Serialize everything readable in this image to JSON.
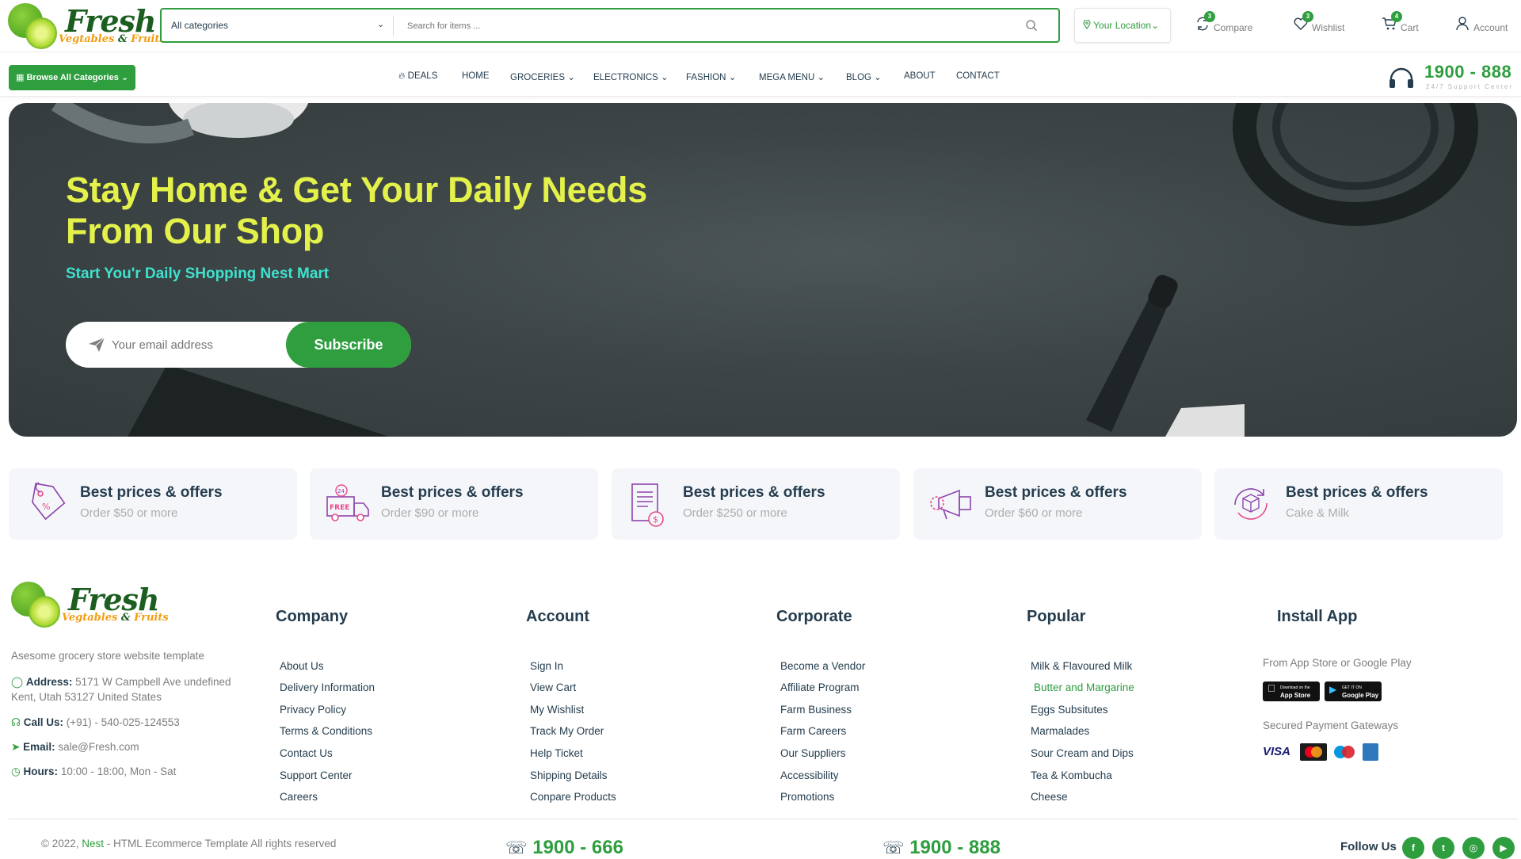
{
  "logo": {
    "word": "Fresh",
    "sub_a": "Vegtables",
    "sub_amp": " & ",
    "sub_b": "Fruits"
  },
  "search": {
    "category": "All categories",
    "placeholder": "Search for items ..."
  },
  "location": {
    "label": "Your Location"
  },
  "actions": {
    "compare": {
      "label": "Compare",
      "count": "3"
    },
    "wishlist": {
      "label": "Wishlist",
      "count": "3"
    },
    "cart": {
      "label": "Cart",
      "count": "4"
    },
    "account": {
      "label": "Account"
    }
  },
  "browse_label": "Browse All Categories",
  "nav": [
    "DEALS",
    "HOME",
    "GROCERIES",
    "ELECTRONICS",
    "FASHION",
    "MEGA MENU",
    "BLOG",
    "ABOUT",
    "CONTACT"
  ],
  "support": {
    "phone": "1900 - 888",
    "sub": "24/7 Support Center"
  },
  "hero": {
    "title": "Stay Home & Get Your Daily Needs From Our Shop",
    "tagline": "Start You'r Daily SHopping Nest Mart",
    "email_placeholder": "Your email address",
    "subscribe": "Subscribe"
  },
  "features": [
    {
      "title": "Best prices & offers",
      "sub": "Order $50 or more",
      "icon": "price-tag-icon"
    },
    {
      "title": "Best prices & offers",
      "sub": "Order $90 or more",
      "icon": "free-delivery-icon"
    },
    {
      "title": "Best prices & offers",
      "sub": "Order $250 or more",
      "icon": "invoice-icon"
    },
    {
      "title": "Best prices & offers",
      "sub": "Order $60 or more",
      "icon": "megaphone-icon"
    },
    {
      "title": "Best prices & offers",
      "sub": "Cake & Milk",
      "icon": "return-box-icon"
    }
  ],
  "footer": {
    "desc": "Asesome grocery store website template",
    "address_label": "Address:",
    "address": "5171 W Campbell Ave undefined Kent, Utah 53127 United States",
    "call_label": "Call Us:",
    "call": "(+91) - 540-025-124553",
    "email_label": "Email:",
    "email": "sale@Fresh.com",
    "hours_label": "Hours:",
    "hours": "10:00 - 18:00, Mon - Sat",
    "columns": [
      {
        "title": "Company",
        "links": [
          "About Us",
          "Delivery Information",
          "Privacy Policy",
          "Terms & Conditions",
          "Contact Us",
          "Support Center",
          "Careers"
        ]
      },
      {
        "title": "Account",
        "links": [
          "Sign In",
          "View Cart",
          "My Wishlist",
          "Track My Order",
          "Help Ticket",
          "Shipping Details",
          "Conpare Products"
        ]
      },
      {
        "title": "Corporate",
        "links": [
          "Become a Vendor",
          "Affiliate Program",
          "Farm Business",
          "Farm Careers",
          "Our Suppliers",
          "Accessibility",
          "Promotions"
        ]
      },
      {
        "title": "Popular",
        "links": [
          "Milk & Flavoured Milk",
          "Butter and Margarine",
          "Eggs Subsitutes",
          "Marmalades",
          "Sour Cream and Dips",
          "Tea & Kombucha",
          "Cheese"
        ]
      }
    ],
    "install": {
      "title": "Install App",
      "from": "From App Store or Google Play",
      "appstore_small": "Download on the",
      "appstore": "App Store",
      "gplay_small": "GET IT ON",
      "gplay": "Google Play",
      "gateways": "Secured Payment Gateways",
      "cards": [
        "VISA",
        "MasterCard",
        "Maestro",
        "AmEx"
      ]
    },
    "copyright_pre": "© 2022, ",
    "copyright_brand": "Nest",
    "copyright_post": " - HTML Ecommerce Template All rights reserved",
    "phone1": "1900 - 666",
    "phone2": "1900 - 888",
    "follow": "Follow Us",
    "social": [
      "f",
      "t",
      "◎",
      "▶"
    ]
  },
  "colors": {
    "brand": "#2e9e3f",
    "hero_title": "#e3f14a",
    "hero_tag": "#3ee2cf",
    "text": "#253d4e",
    "muted": "#7e7e7e"
  }
}
